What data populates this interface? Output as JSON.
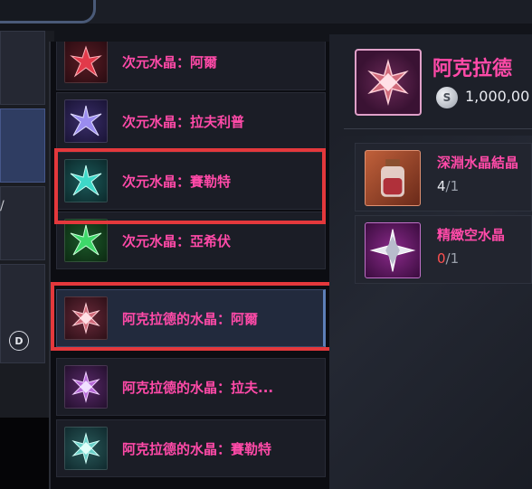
{
  "list": {
    "items": [
      {
        "label": "次元水晶：阿爾",
        "icon": "red-crystal-icon"
      },
      {
        "label": "次元水晶：拉夫利普",
        "icon": "blue-crystal-icon"
      },
      {
        "label": "次元水晶：賽勒特",
        "icon": "cyan-crystal-icon"
      },
      {
        "label": "次元水晶：亞希伏",
        "icon": "green-crystal-icon"
      },
      {
        "label": "阿克拉德的水晶：阿爾",
        "icon": "pink-gem-icon",
        "selected": true
      },
      {
        "label": "阿克拉德的水晶：拉夫...",
        "icon": "purple-gem-icon"
      },
      {
        "label": "阿克拉德的水晶：賽勒特",
        "icon": "teal-gem-icon"
      }
    ]
  },
  "left_tabs": {
    "badge": "D"
  },
  "detail": {
    "title": "阿克拉德",
    "price": "1,000,00",
    "coin_symbol": "S",
    "materials": [
      {
        "name": "深淵水晶結晶",
        "have": "4",
        "sep": "/",
        "need": "1",
        "icon": "jar-icon"
      },
      {
        "name": "精緻空水晶",
        "have": "0",
        "sep": "/",
        "need": "1",
        "icon": "silver-star-crystal-icon"
      }
    ]
  },
  "colors": {
    "accent_pink": "#ff4aa8",
    "highlight_red": "#e4383c",
    "selection_blue": "#5d7fb8"
  }
}
